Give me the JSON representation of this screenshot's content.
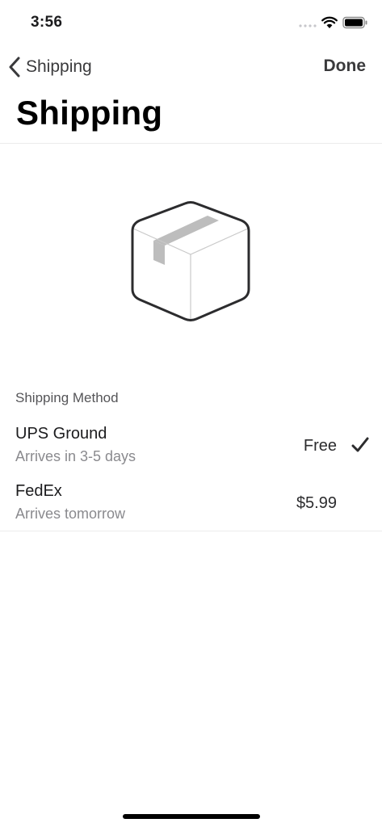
{
  "status_bar": {
    "time": "3:56"
  },
  "nav": {
    "back_label": "Shipping",
    "done_label": "Done"
  },
  "page": {
    "title": "Shipping"
  },
  "shipping": {
    "section_header": "Shipping Method",
    "methods": [
      {
        "name": "UPS Ground",
        "subtitle": "Arrives in 3-5 days",
        "price": "Free",
        "selected": true
      },
      {
        "name": "FedEx",
        "subtitle": "Arrives tomorrow",
        "price": "$5.99",
        "selected": false
      }
    ]
  },
  "icons": {
    "back": "chevron-left-icon",
    "illustration": "package-box-icon",
    "selected": "checkmark-icon"
  },
  "colors": {
    "background": "#ffffff",
    "text": "#1c1c1e",
    "secondary_text": "#8a8a8e",
    "tape": "#bdbdbd",
    "divider": "#ececec"
  }
}
